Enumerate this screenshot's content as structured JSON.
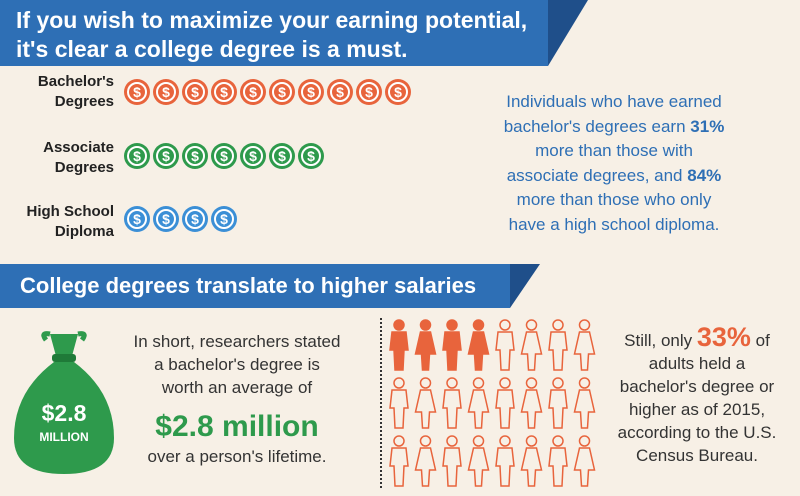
{
  "headline": {
    "line1": "If you wish to maximize your earning potential,",
    "line2": "it's clear a college degree is a must."
  },
  "degrees": [
    {
      "label_line1": "Bachelor's",
      "label_line2": "Degrees",
      "coins": 10,
      "color": "#e8643c"
    },
    {
      "label_line1": "Associate",
      "label_line2": "Degrees",
      "coins": 7,
      "color": "#2e9a4c"
    },
    {
      "label_line1": "High School",
      "label_line2": "Diploma",
      "coins": 4,
      "color": "#3b8fd6"
    }
  ],
  "coin_symbol": "$",
  "comparison": {
    "line1": "Individuals who have earned",
    "line2_pre": "bachelor's degrees earn ",
    "pct_associate": "31%",
    "line3": "more than those with",
    "line4_pre": "associate degrees, and ",
    "pct_highschool": "84%",
    "line5": "more than those who only",
    "line6": "have a high school diploma."
  },
  "section2_title": "College degrees translate to higher salaries",
  "bag": {
    "value": "$2.8",
    "unit": "MILLION",
    "color": "#2e9a4c"
  },
  "worth": {
    "line1": "In short, researchers stated",
    "line2": "a bachelor's degree is",
    "line3": "worth an average of",
    "amount": "$2.8 million",
    "line4": "over a person's lifetime."
  },
  "people_grid": {
    "rows": 3,
    "cols": 8,
    "filled": 4,
    "filled_color": "#e8643c",
    "icon_pattern": [
      "male",
      "female"
    ]
  },
  "census": {
    "pre": "Still, only ",
    "pct": "33%",
    "post": " of",
    "line2": "adults held a",
    "line3": "bachelor's degree or",
    "line4": "higher as of 2015,",
    "line5": "according to the U.S.",
    "line6": "Census Bureau."
  }
}
